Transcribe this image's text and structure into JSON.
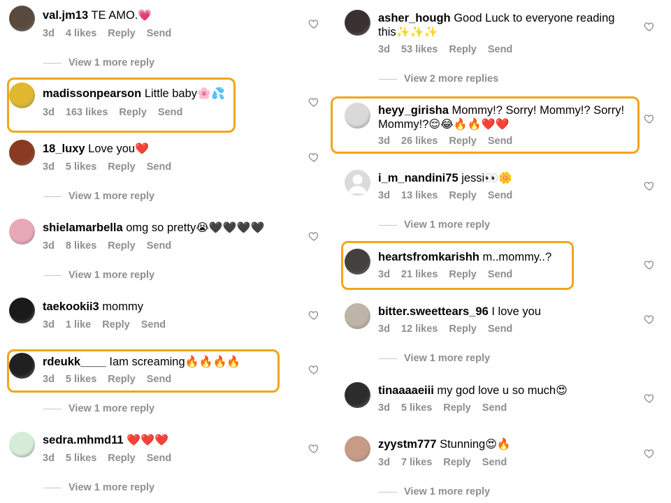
{
  "colors": {
    "highlight": "#f2a51b",
    "meta_text": "#8e8e8e"
  },
  "left": [
    {
      "id": "l1",
      "username": "val.jm13",
      "text": "TE AMO.",
      "emoji": "💗",
      "age": "3d",
      "likes": "4 likes",
      "reply": "Reply",
      "send": "Send",
      "view_more": "View 1 more reply",
      "avatar_icon": "user-avatar",
      "highlighted": false
    },
    {
      "id": "l2",
      "username": "madissonpearson",
      "text": "Little baby",
      "emoji": "🌸💦",
      "age": "3d",
      "likes": "163 likes",
      "reply": "Reply",
      "send": "Send",
      "view_more": "",
      "avatar_icon": "user-avatar",
      "highlighted": true
    },
    {
      "id": "l3",
      "username": "18_luxy",
      "text": "Love you",
      "emoji": "❤️",
      "age": "3d",
      "likes": "5 likes",
      "reply": "Reply",
      "send": "Send",
      "view_more": "View 1 more reply",
      "avatar_icon": "user-avatar",
      "highlighted": false
    },
    {
      "id": "l4",
      "username": "shielamarbella",
      "text": "omg so pretty",
      "emoji": "😭🖤🖤🖤🖤",
      "age": "3d",
      "likes": "8 likes",
      "reply": "Reply",
      "send": "Send",
      "view_more": "View 1 more reply",
      "avatar_icon": "user-avatar",
      "highlighted": false
    },
    {
      "id": "l5",
      "username": "taekookii3",
      "text": "mommy",
      "emoji": "",
      "age": "3d",
      "likes": "1 like",
      "reply": "Reply",
      "send": "Send",
      "view_more": "",
      "avatar_icon": "user-avatar",
      "highlighted": false
    },
    {
      "id": "l6",
      "username": "rdeukk____",
      "text": "Iam screaming",
      "emoji": "🔥🔥🔥🔥",
      "age": "3d",
      "likes": "5 likes",
      "reply": "Reply",
      "send": "Send",
      "view_more": "View 1 more reply",
      "avatar_icon": "user-avatar",
      "highlighted": true
    },
    {
      "id": "l7",
      "username": "sedra.mhmd11",
      "text": "",
      "emoji": "❤️❤️❤️",
      "age": "3d",
      "likes": "5 likes",
      "reply": "Reply",
      "send": "Send",
      "view_more": "View 1 more reply",
      "avatar_icon": "user-avatar",
      "highlighted": false
    }
  ],
  "right": [
    {
      "id": "r1",
      "username": "asher_hough",
      "text": "Good Luck to everyone reading this",
      "emoji": "✨✨✨",
      "age": "3d",
      "likes": "53 likes",
      "reply": "Reply",
      "send": "Send",
      "view_more": "View 2 more replies",
      "avatar_icon": "user-avatar",
      "highlighted": false
    },
    {
      "id": "r2",
      "username": "heyy_girisha",
      "text": "Mommy!? Sorry! Mommy!? Sorry! Mommy!?",
      "emoji": "😌😂🔥🔥❤️❤️",
      "age": "3d",
      "likes": "26 likes",
      "reply": "Reply",
      "send": "Send",
      "view_more": "",
      "avatar_icon": "user-avatar",
      "highlighted": true
    },
    {
      "id": "r3",
      "username": "i_m_nandini75",
      "text": "jessi",
      "emoji": "👀🌼",
      "age": "3d",
      "likes": "13 likes",
      "reply": "Reply",
      "send": "Send",
      "view_more": "View 1 more reply",
      "avatar_icon": "default-avatar",
      "highlighted": false
    },
    {
      "id": "r4",
      "username": "heartsfromkarishh",
      "text": "m..mommy..?",
      "emoji": "",
      "age": "3d",
      "likes": "21 likes",
      "reply": "Reply",
      "send": "Send",
      "view_more": "",
      "avatar_icon": "user-avatar",
      "highlighted": true
    },
    {
      "id": "r5",
      "username": "bitter.sweettears_96",
      "text": "I love you",
      "emoji": "",
      "age": "3d",
      "likes": "12 likes",
      "reply": "Reply",
      "send": "Send",
      "view_more": "View 1 more reply",
      "avatar_icon": "user-avatar",
      "highlighted": false
    },
    {
      "id": "r6",
      "username": "tinaaaaeiii",
      "text": "my god love u so much",
      "emoji": "😍",
      "age": "3d",
      "likes": "5 likes",
      "reply": "Reply",
      "send": "Send",
      "view_more": "",
      "avatar_icon": "user-avatar",
      "highlighted": false
    },
    {
      "id": "r7",
      "username": "zyystm777",
      "text": "Stunning",
      "emoji": "😍🔥",
      "age": "3d",
      "likes": "7 likes",
      "reply": "Reply",
      "send": "Send",
      "view_more": "View 1 more reply",
      "avatar_icon": "user-avatar",
      "highlighted": false
    }
  ]
}
